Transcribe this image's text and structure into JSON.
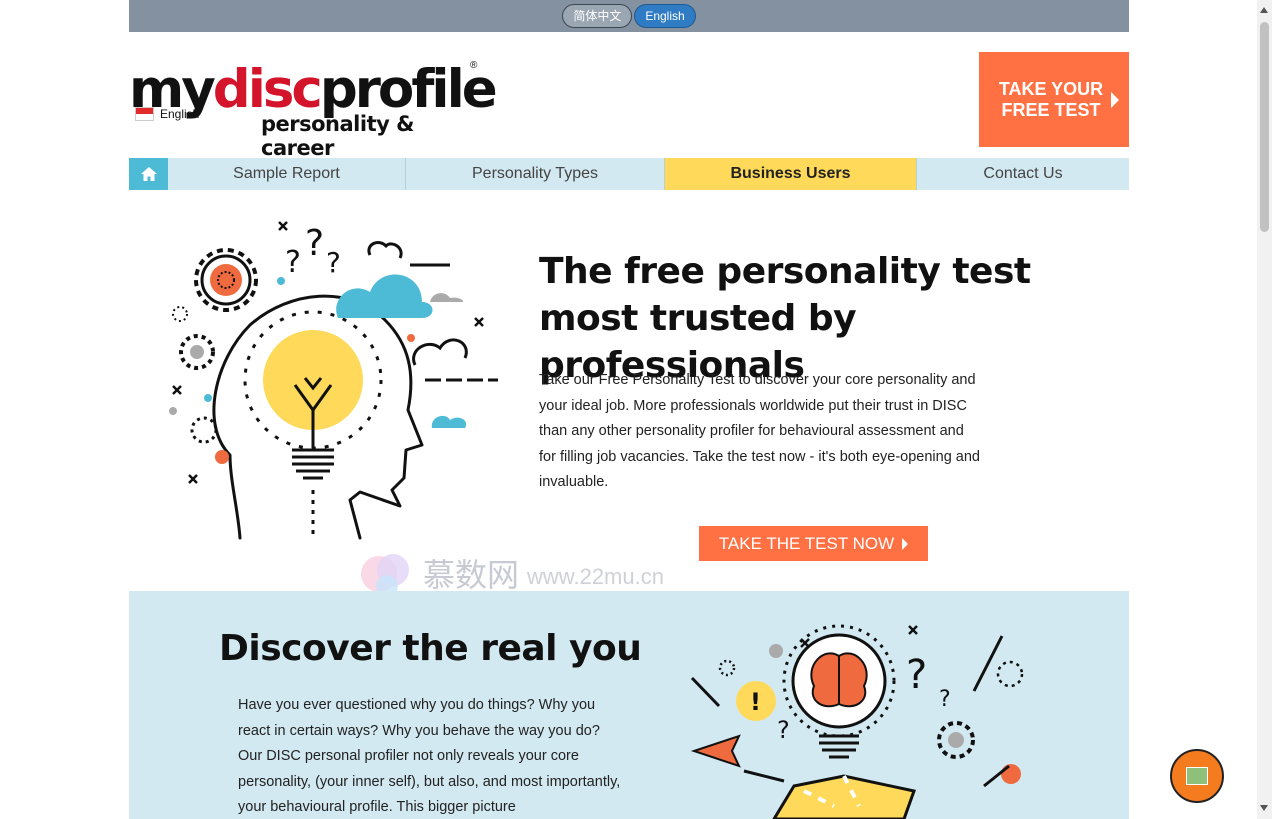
{
  "lang_bar": {
    "chinese": "简体中文",
    "english": "English"
  },
  "logo": {
    "prefix": "my",
    "highlight": "disc",
    "suffix": "profile",
    "reg": "®",
    "tagline": "personality & career"
  },
  "language_indicator": "English",
  "free_test_button": {
    "line1": "TAKE YOUR",
    "line2": "FREE TEST"
  },
  "nav": [
    {
      "label": "Sample Report",
      "active": false
    },
    {
      "label": "Personality Types",
      "active": false
    },
    {
      "label": "Business Users",
      "active": true
    },
    {
      "label": "Contact Us",
      "active": false
    }
  ],
  "hero": {
    "title_pre": "The ",
    "title_bold": "free personality test",
    "title_post": " most trusted by professionals",
    "body": "Take our Free Personality Test to discover your core personality and your ideal job. More professionals worldwide put their trust in DISC than any other personality profiler for behavioural assessment and for filling job vacancies. Take the test now - it's both eye-opening and invaluable.",
    "cta": "TAKE THE TEST NOW"
  },
  "watermark": {
    "cn": "慕数网",
    "url": "www.22mu.cn"
  },
  "discover": {
    "title_pre": "Discover the ",
    "title_bold": "real you",
    "body": "Have you ever questioned why you do things? Why you react in certain ways? Why you behave the way you do? Our DISC personal profiler not only reveals your core personality, (your inner self), but also, and most importantly, your behavioural profile. This bigger picture"
  },
  "colors": {
    "orange": "#ff7043",
    "nav_bg": "#d3e9f1",
    "nav_active": "#ffd95a",
    "home_blue": "#4ebbd6",
    "topbar": "#8391a0",
    "logo_red": "#d4142a"
  },
  "icons": {
    "home": "home-icon",
    "chat": "chat-icon",
    "flag": "flag-icon"
  }
}
